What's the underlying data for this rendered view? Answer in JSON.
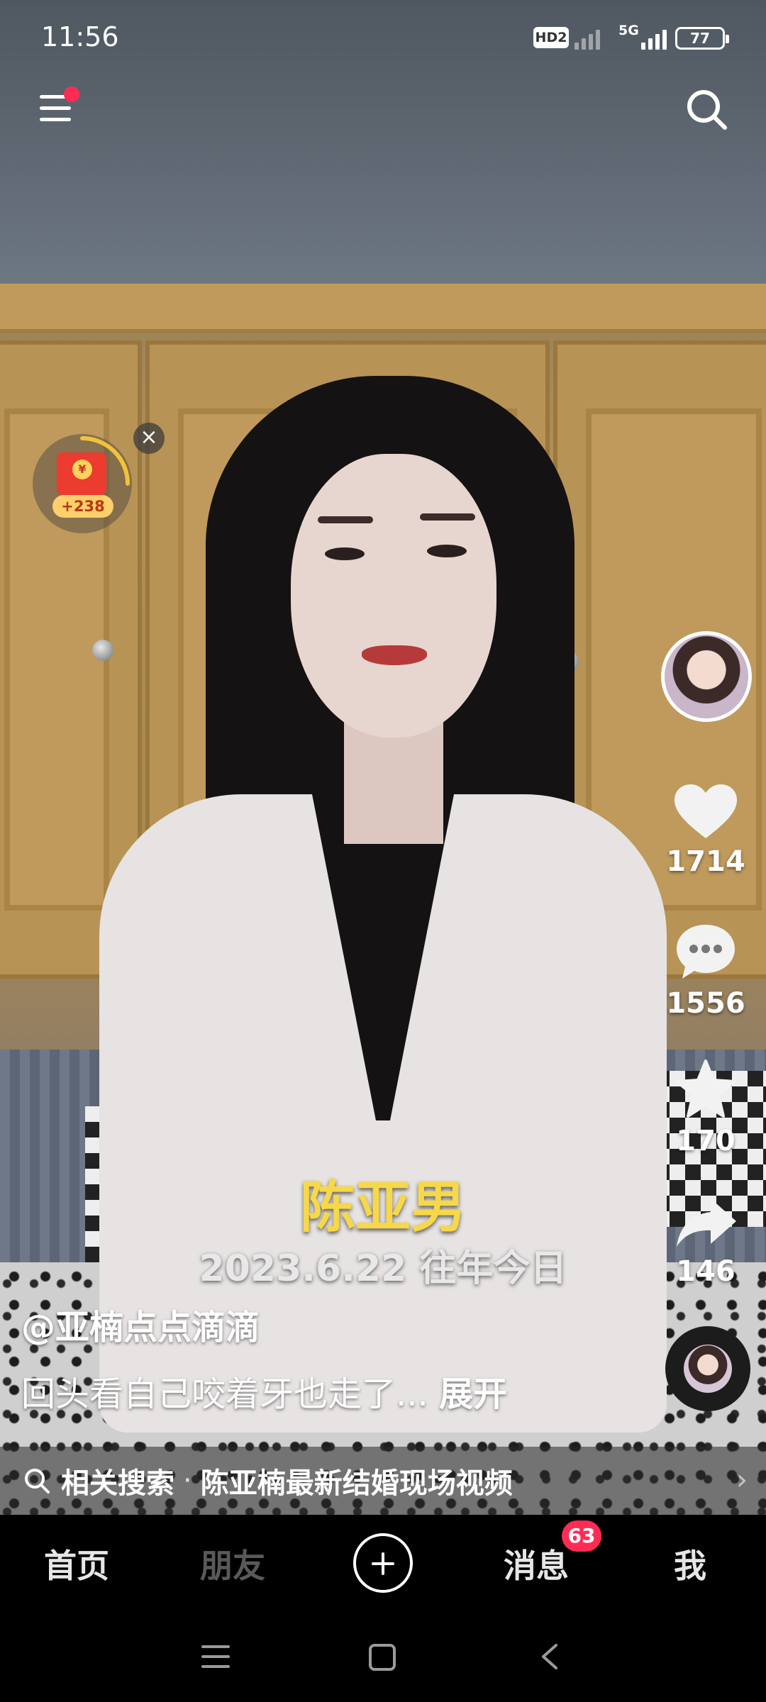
{
  "status_bar": {
    "time": "11:56",
    "hd_label": "HD2",
    "network": "5G",
    "battery": "77"
  },
  "top_bar": {
    "menu_icon": "hamburger-menu-icon",
    "search_icon": "search-icon",
    "has_notification_dot": true
  },
  "red_packet": {
    "reward": "+238",
    "coin_symbol": "¥",
    "close_symbol": "×"
  },
  "video": {
    "overlay_name": "陈亚男",
    "overlay_date": "2023.6.22 往年今日"
  },
  "actions": {
    "likes": "1714",
    "comments": "1556",
    "favorites": "170",
    "shares": "146"
  },
  "post": {
    "author": "@亚楠点点滴滴",
    "description": "回头看自己咬着牙也走了...",
    "expand_label": "展开"
  },
  "related_search": {
    "label": "相关搜索",
    "separator": "·",
    "query": "陈亚楠最新结婚现场视频",
    "chevron": "›"
  },
  "bottom_nav": {
    "home": "首页",
    "friends": "朋友",
    "messages": "消息",
    "messages_badge": "63",
    "me": "我"
  },
  "colors": {
    "accent": "#fe2c55",
    "overlay_name": "#f6d84a"
  }
}
